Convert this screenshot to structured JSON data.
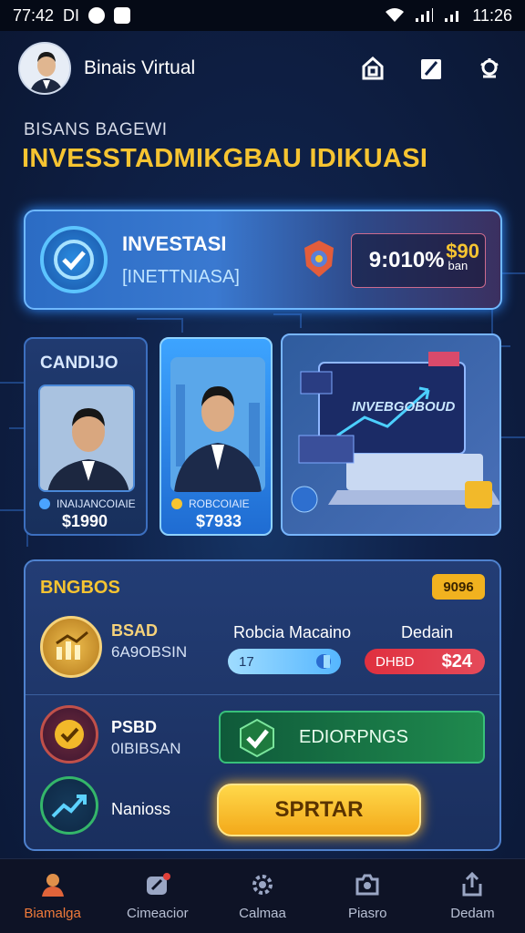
{
  "status_bar": {
    "time_left": "77:42",
    "carrier": "DI",
    "time_right": "11:26"
  },
  "header": {
    "app_name": "Binais Virtual",
    "icons": [
      "home-icon",
      "edit-icon",
      "settings-icon"
    ]
  },
  "hero": {
    "subtitle": "BISANS BAGEWI",
    "headline": "INVESSTADMIKGBAU IDIKUASI"
  },
  "banner": {
    "title": "INVESTASI",
    "subtitle": "[INETTNIASA]",
    "percent": "9:010%",
    "percent_unit": "ban",
    "gold_value": "$90"
  },
  "cards": [
    {
      "title": "CANDIJO",
      "name": "INAIJANCOIAIE",
      "price": "$1990"
    },
    {
      "name": "ROBCOIAIE",
      "price": "$7933"
    },
    {
      "screen_text": "INVEBGOBOUD"
    }
  ],
  "panel": {
    "title": "BNGBOS",
    "tag": "9096",
    "col_headers": [
      "Robcia Macaino",
      "Dedain"
    ],
    "rows": [
      {
        "label": "BSAD",
        "sub": "6A9OBSIN",
        "blue_value": "17",
        "red_left": "DHBD",
        "red_right": "$24"
      },
      {
        "label": "PSBD",
        "sub": "0IBIBSAN"
      },
      {
        "label": "Nanioss"
      }
    ],
    "green_button": "EDIORPNGS",
    "start_button": "SPRTAR"
  },
  "tabs": [
    {
      "label": "Biamalga",
      "icon": "profile-icon",
      "active": true
    },
    {
      "label": "Cimeacior",
      "icon": "chat-icon",
      "active": false
    },
    {
      "label": "Calmaa",
      "icon": "gear-icon",
      "active": false
    },
    {
      "label": "Piasro",
      "icon": "camera-icon",
      "active": false
    },
    {
      "label": "Dedam",
      "icon": "share-icon",
      "active": false
    }
  ]
}
